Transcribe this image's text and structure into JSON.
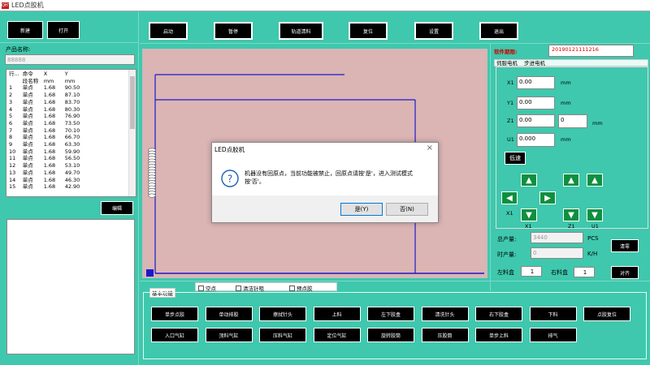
{
  "window": {
    "title": "LED点胶机",
    "logo": "QHT"
  },
  "left_toolbar": {
    "new_label": "新建",
    "open_label": "打开"
  },
  "top_toolbar": [
    {
      "name": "start-button",
      "label": "启动"
    },
    {
      "name": "pause-button",
      "label": "暂停"
    },
    {
      "name": "clean-button",
      "label": "轨道清料"
    },
    {
      "name": "reset-button",
      "label": "复位"
    },
    {
      "name": "settings-button",
      "label": "设置"
    },
    {
      "name": "exit-button",
      "label": "退出"
    }
  ],
  "product": {
    "name_label": "产品名称:",
    "name_value": "88888"
  },
  "program_table": {
    "headers": [
      "行...",
      "命令",
      "X",
      "Y"
    ],
    "subheader": [
      "",
      "段名称",
      "mm",
      "mm"
    ],
    "rows": [
      [
        "1",
        "单点",
        "1.68",
        "90.50"
      ],
      [
        "2",
        "单点",
        "1.68",
        "87.10"
      ],
      [
        "3",
        "单点",
        "1.68",
        "83.70"
      ],
      [
        "4",
        "单点",
        "1.68",
        "80.30"
      ],
      [
        "5",
        "单点",
        "1.68",
        "76.90"
      ],
      [
        "6",
        "单点",
        "1.68",
        "73.50"
      ],
      [
        "7",
        "单点",
        "1.68",
        "70.10"
      ],
      [
        "8",
        "单点",
        "1.68",
        "66.70"
      ],
      [
        "9",
        "单点",
        "1.68",
        "63.30"
      ],
      [
        "10",
        "单点",
        "1.68",
        "59.90"
      ],
      [
        "11",
        "单点",
        "1.68",
        "56.50"
      ],
      [
        "12",
        "单点",
        "1.68",
        "53.10"
      ],
      [
        "13",
        "单点",
        "1.68",
        "49.70"
      ],
      [
        "14",
        "单点",
        "1.68",
        "46.30"
      ],
      [
        "15",
        "单点",
        "1.68",
        "42.90"
      ]
    ]
  },
  "edit_label": "编辑",
  "software_date": {
    "label": "软件期限:",
    "value": "20190121111216"
  },
  "motor_tabs": [
    "伺服电机",
    "步进电机"
  ],
  "axes": [
    {
      "label": "X1",
      "value": "0.00",
      "unit": "mm"
    },
    {
      "label": "Y1",
      "value": "0.00",
      "unit": "mm"
    },
    {
      "label": "Z1",
      "value": "0.00",
      "extra": "0",
      "unit": "mm"
    },
    {
      "label": "U1",
      "value": "0.000",
      "unit": "mm"
    }
  ],
  "speed_label": "低速",
  "jog_labels": {
    "x": "X1",
    "z": "Z1",
    "u": "U1"
  },
  "production": {
    "total_label": "总产量:",
    "total_value": "3440",
    "total_unit": "PCS",
    "hour_label": "时产量:",
    "hour_value": "0",
    "hour_unit": "K/H",
    "clear_label": "清零"
  },
  "magazines": {
    "left_label": "左料盒",
    "left_value": "1",
    "right_label": "右料盒",
    "right_value": "1",
    "align_label": "对齐"
  },
  "dialog": {
    "title": "LED点胶机",
    "message": "机器没有回原点，当前功能被禁止，回原点请按'是'，进入测试模式按'否'。",
    "yes_label": "是(Y)",
    "no_label": "否(N)"
  },
  "basic": {
    "group_label": "基本功能",
    "checkboxes": [
      "空点",
      "清洁针咀",
      "预点胶"
    ],
    "row1": [
      "单步点胶",
      "单动排胶",
      "擦拭针头",
      "上料",
      "左下胶盒",
      "清洗针头",
      "右下胶盒",
      "下料",
      "点胶复位"
    ],
    "row2": [
      "入口气缸",
      "顶料气缸",
      "压料气缸",
      "定位气缸",
      "旋转胶筒",
      "压胶筒",
      "单步上料",
      "排气"
    ]
  },
  "colors": {
    "background": "#3fc8ad",
    "canvas": "#dbb4b4",
    "path": "#1a1acc",
    "arrow": "#0f8f40"
  }
}
